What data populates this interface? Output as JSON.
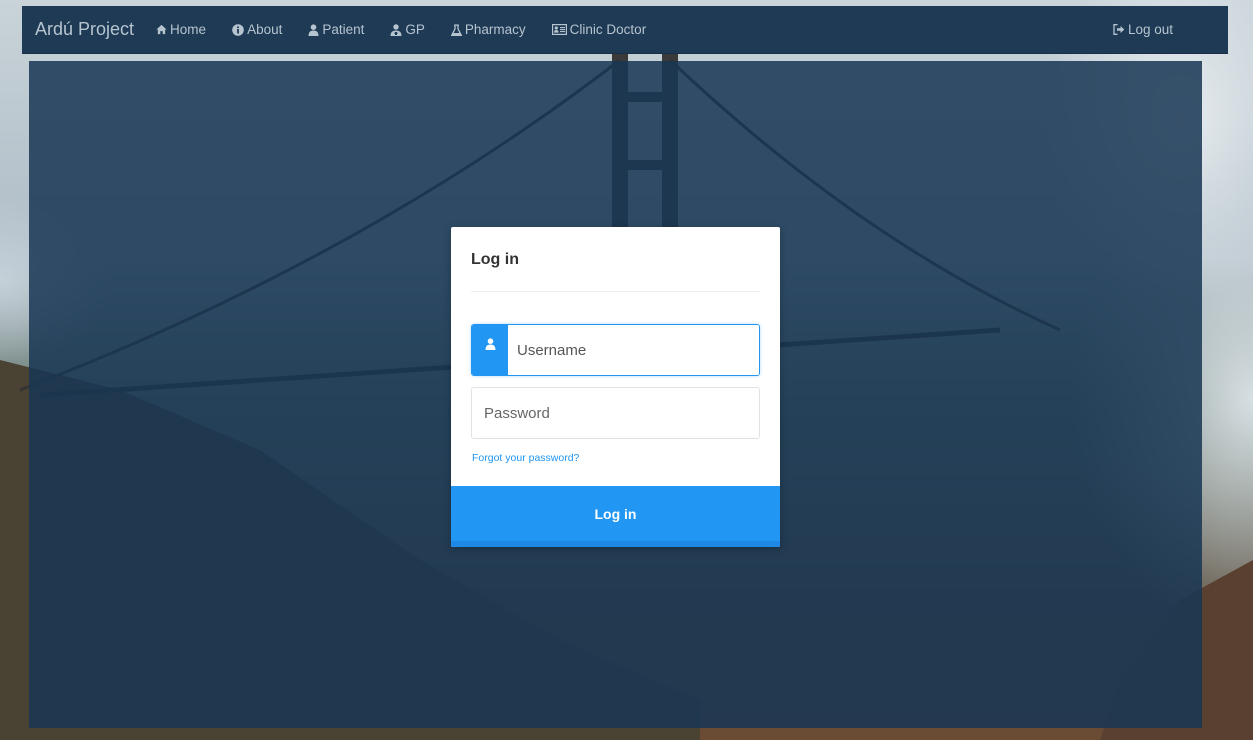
{
  "navbar": {
    "brand": "Ardú Project",
    "items": [
      {
        "label": "Home",
        "icon": "home-icon"
      },
      {
        "label": "About",
        "icon": "info-icon"
      },
      {
        "label": "Patient",
        "icon": "user-icon"
      },
      {
        "label": "GP",
        "icon": "doctor-icon"
      },
      {
        "label": "Pharmacy",
        "icon": "flask-icon"
      },
      {
        "label": "Clinic Doctor",
        "icon": "id-card-icon"
      }
    ],
    "logout": {
      "label": "Log out",
      "icon": "logout-icon"
    }
  },
  "login": {
    "title": "Log in",
    "username_placeholder": "Username",
    "password_placeholder": "Password",
    "forgot_label": "Forgot your password?",
    "submit_label": "Log in"
  },
  "colors": {
    "accent": "#2196f3",
    "navbar": "#1e3a54",
    "overlay": "#183754",
    "nav_text": "#b6c4d0"
  }
}
